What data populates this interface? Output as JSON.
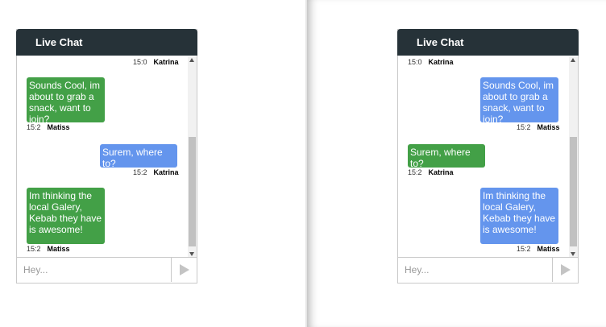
{
  "left_chat": {
    "title": "Live Chat",
    "top_meta": {
      "time": "15:0",
      "sender": "Katrina"
    },
    "messages": [
      {
        "text": "Sounds Cool, im about to grab a snack, want to join?",
        "time": "15:2",
        "sender": "Matiss"
      },
      {
        "text": "Surem, where to?",
        "time": "15:2",
        "sender": "Katrina"
      },
      {
        "text": "Im thinking the local Galery, Kebab they have is awesome!",
        "time": "15:2",
        "sender": "Matiss"
      }
    ],
    "input_placeholder": "Hey..."
  },
  "right_chat": {
    "title": "Live Chat",
    "top_meta": {
      "time": "15:0",
      "sender": "Katrina"
    },
    "messages": [
      {
        "text": "Sounds Cool, im about to grab a snack, want to join?",
        "time": "15:2",
        "sender": "Matiss"
      },
      {
        "text": "Surem, where to?",
        "time": "15:2",
        "sender": "Katrina"
      },
      {
        "text": "Im thinking the local Galery, Kebab they have is awesome!",
        "time": "15:2",
        "sender": "Matiss"
      }
    ],
    "input_placeholder": "Hey..."
  },
  "icons": {
    "send": "send-icon",
    "scroll_up": "scroll-up-icon",
    "scroll_down": "scroll-down-icon"
  },
  "colors": {
    "header": "#263238",
    "green_bubble": "#43a047",
    "blue_bubble": "#6495ed"
  }
}
